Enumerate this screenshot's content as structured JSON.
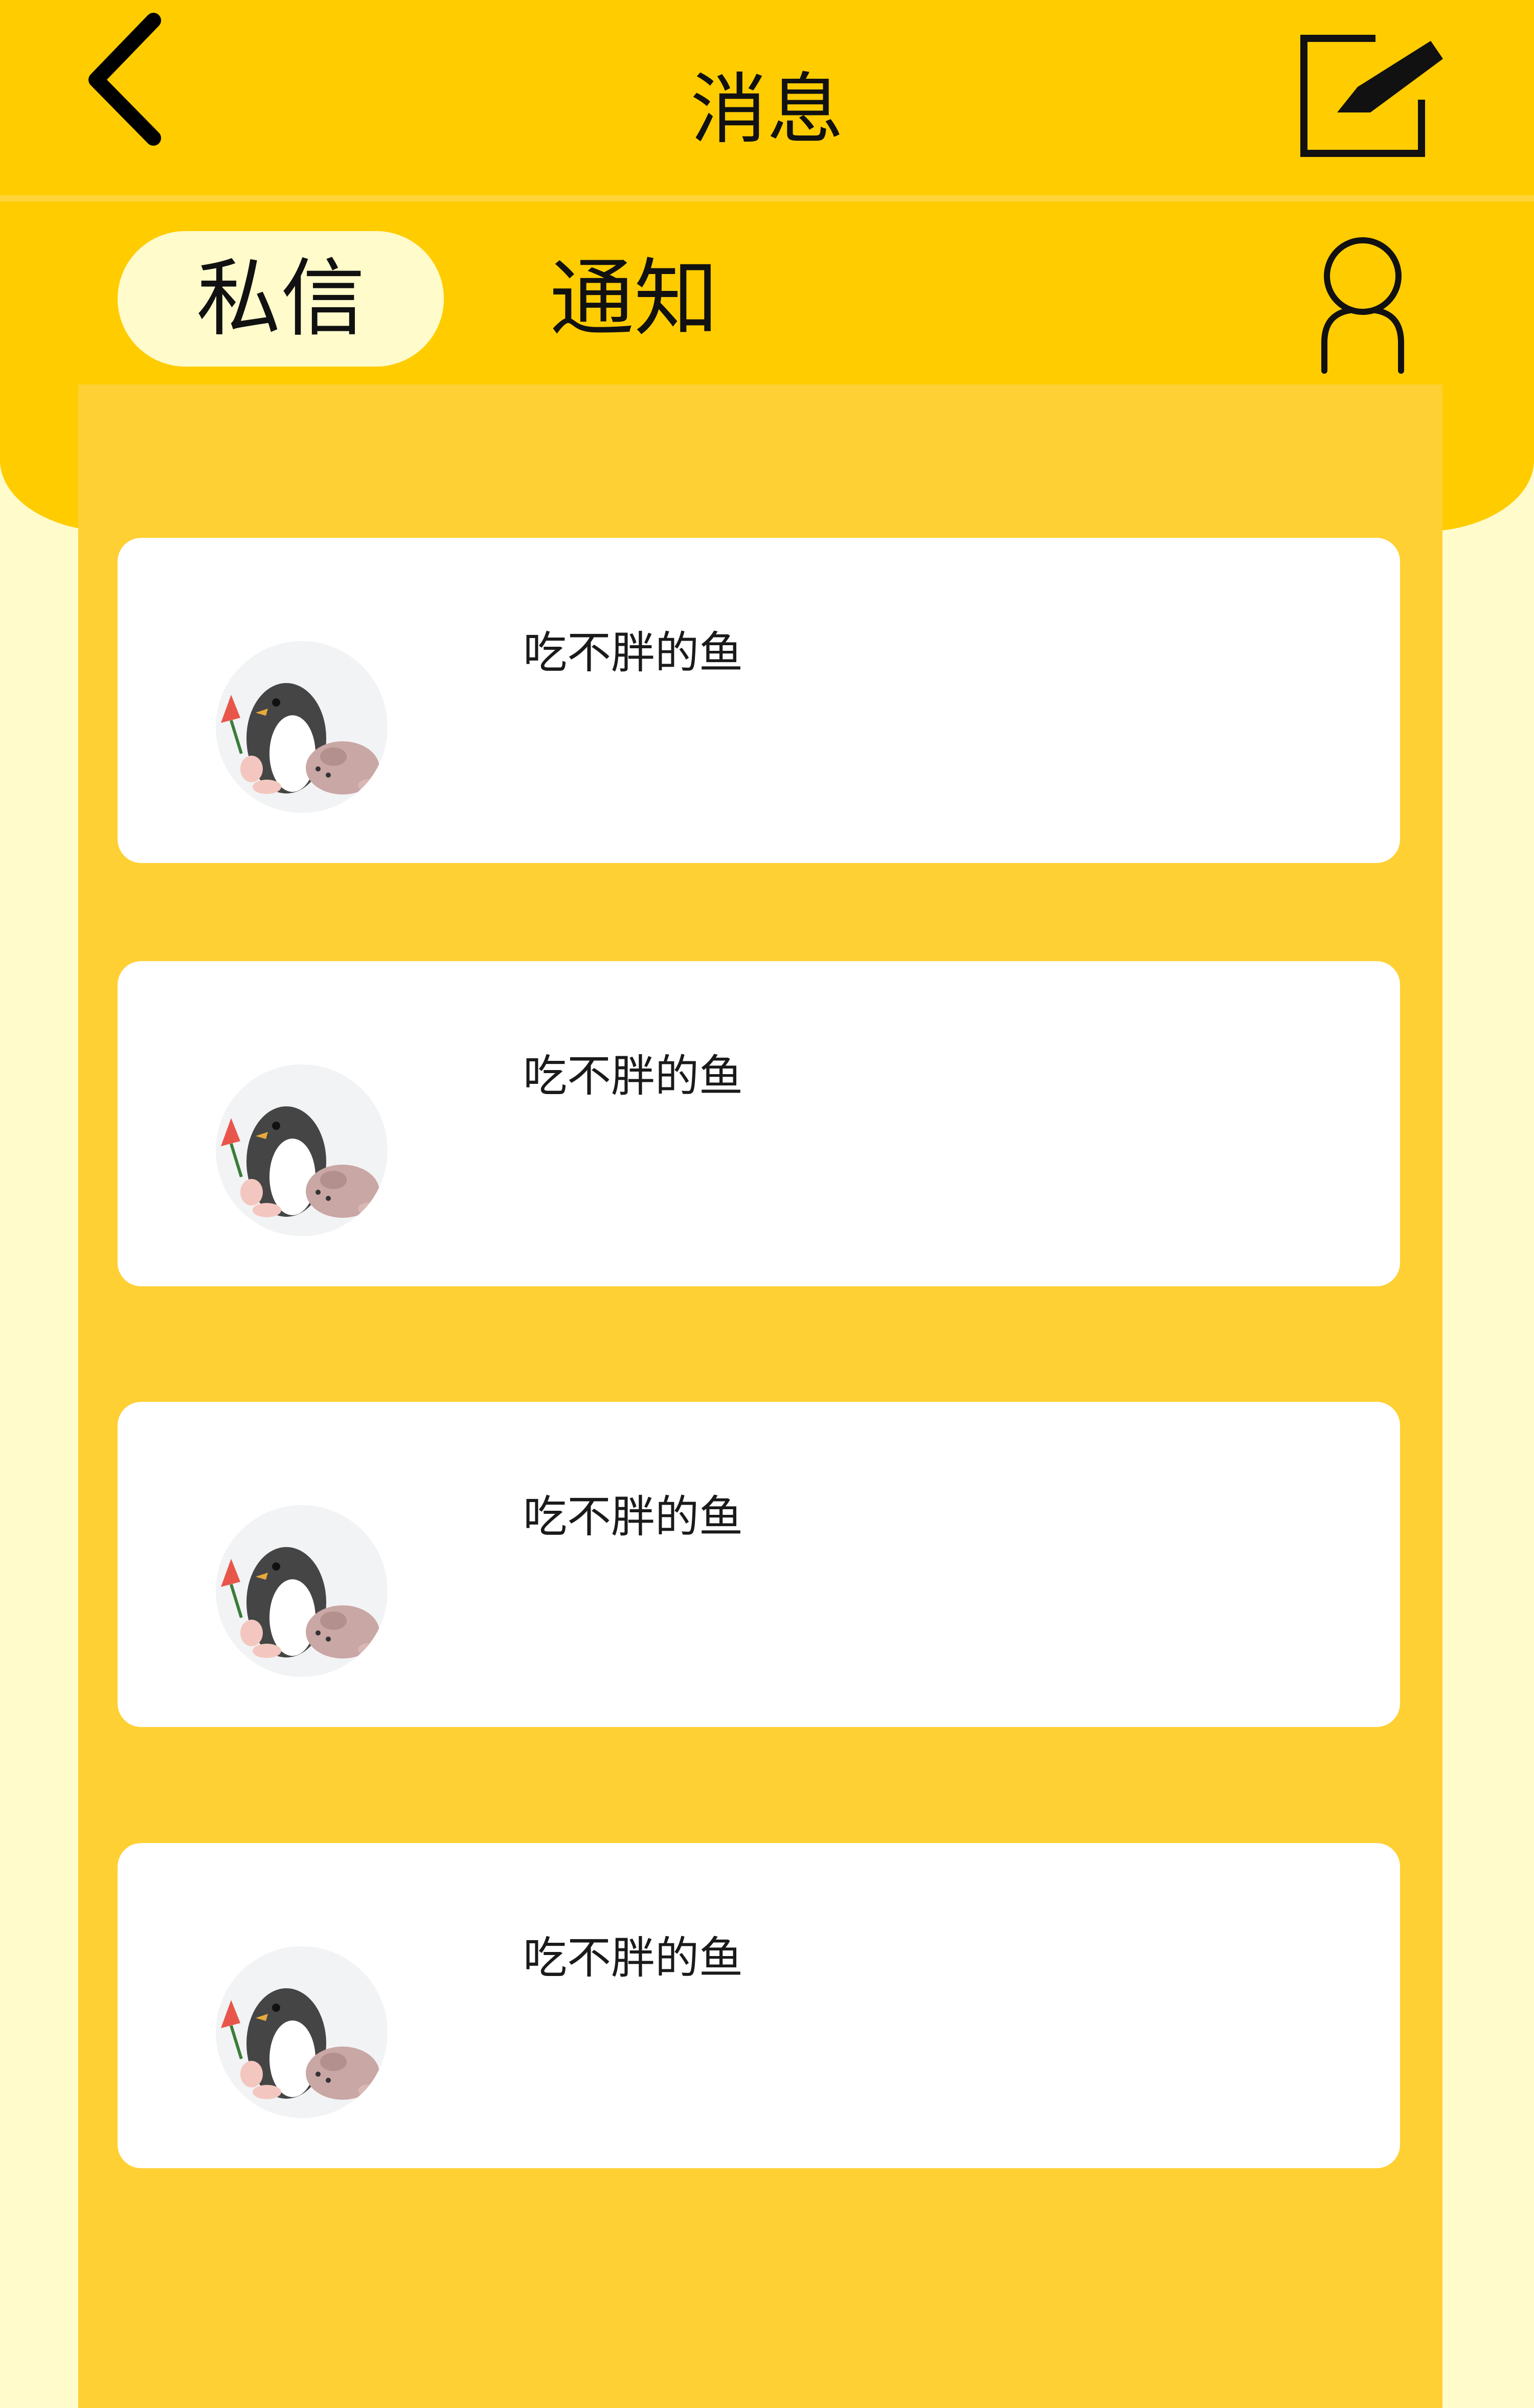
{
  "header": {
    "title": "消息",
    "back_icon": "chevron-left-icon",
    "compose_icon": "edit-icon"
  },
  "tabs": [
    {
      "label": "私信",
      "active": true
    },
    {
      "label": "通知",
      "active": false
    }
  ],
  "profile_icon": "user-icon",
  "colors": {
    "header": "#FFCC00",
    "panel": "#FFD034",
    "background": "#FFFBCB",
    "card": "#FFFFFF"
  },
  "conversations": [
    {
      "name": "吃不胖的鱼",
      "avatar": "penguin-avatar"
    },
    {
      "name": "吃不胖的鱼",
      "avatar": "penguin-avatar"
    },
    {
      "name": "吃不胖的鱼",
      "avatar": "penguin-avatar"
    },
    {
      "name": "吃不胖的鱼",
      "avatar": "penguin-avatar"
    }
  ]
}
